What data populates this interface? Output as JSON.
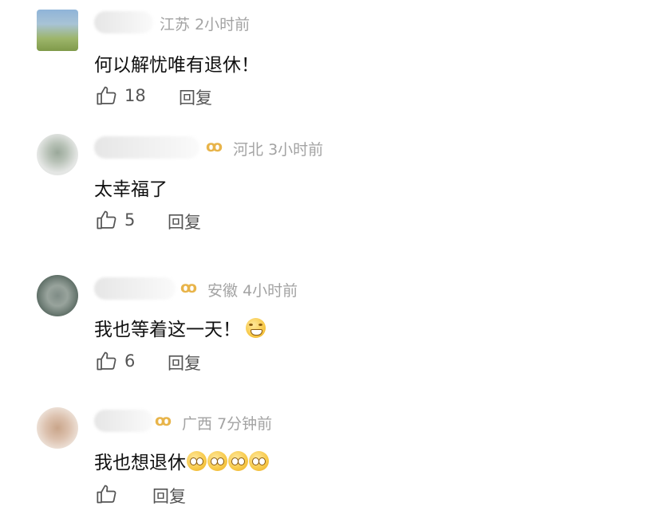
{
  "comments": [
    {
      "location": "江苏",
      "time": "2小时前",
      "text": "何以解忧唯有退休！",
      "likes": "18",
      "reply": "回复",
      "vip": false
    },
    {
      "location": "河北",
      "time": "3小时前",
      "text": "太幸福了",
      "likes": "5",
      "reply": "回复",
      "vip": true
    },
    {
      "location": "安徽",
      "time": "4小时前",
      "text": "我也等着这一天！",
      "likes": "6",
      "reply": "回复",
      "vip": true
    },
    {
      "location": "广西",
      "time": "7分钟前",
      "text": "我也想退休",
      "likes": "",
      "reply": "回复",
      "vip": true
    }
  ],
  "colors": {
    "meta": "#a3a3a3",
    "vip": "#e8b44a",
    "text": "#111111"
  },
  "icons": {
    "like": "thumbs-up-icon",
    "vip": "vip-badge-icon"
  }
}
